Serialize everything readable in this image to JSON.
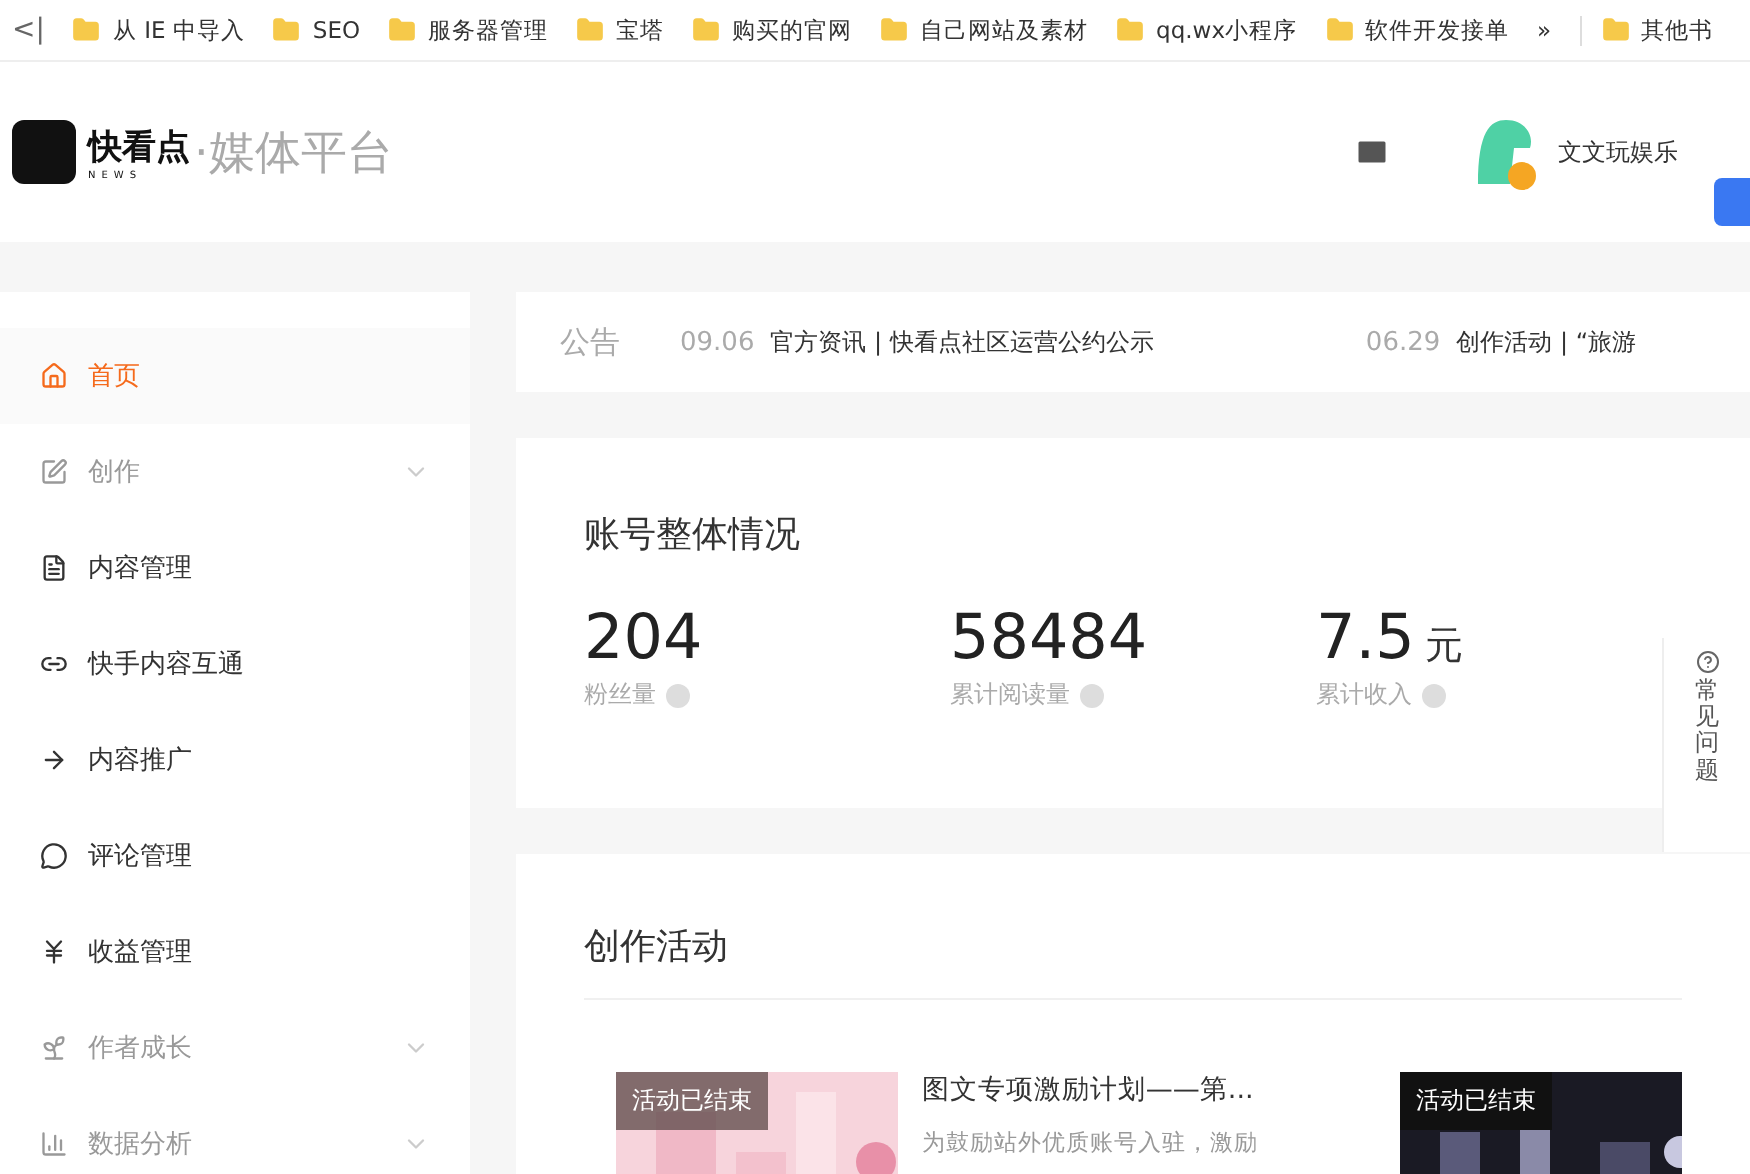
{
  "bookmarks": {
    "back": "<|",
    "items": [
      "从 IE 中导入",
      "SEO",
      "服务器管理",
      "宝塔",
      "购买的官网",
      "自己网站及素材",
      "qq.wx小程序",
      "软件开发接单"
    ],
    "more": "»",
    "other": "其他书"
  },
  "header": {
    "logo_text": "快看点",
    "logo_sub": "NEWS",
    "platform": "·媒体平台",
    "username": "文文玩娱乐"
  },
  "sidebar": {
    "items": [
      {
        "label": "首页",
        "selected": true,
        "expandable": false,
        "disabled": false
      },
      {
        "label": "创作",
        "selected": false,
        "expandable": true,
        "disabled": true
      },
      {
        "label": "内容管理",
        "selected": false,
        "expandable": false,
        "disabled": false
      },
      {
        "label": "快手内容互通",
        "selected": false,
        "expandable": false,
        "disabled": false
      },
      {
        "label": "内容推广",
        "selected": false,
        "expandable": false,
        "disabled": false
      },
      {
        "label": "评论管理",
        "selected": false,
        "expandable": false,
        "disabled": false
      },
      {
        "label": "收益管理",
        "selected": false,
        "expandable": false,
        "disabled": false
      },
      {
        "label": "作者成长",
        "selected": false,
        "expandable": true,
        "disabled": true
      },
      {
        "label": "数据分析",
        "selected": false,
        "expandable": true,
        "disabled": true
      }
    ]
  },
  "notice": {
    "label": "公告",
    "items": [
      {
        "date": "09.06",
        "category": "官方资讯",
        "separator": "|",
        "title": "快看点社区运营公约公示"
      },
      {
        "date": "06.29",
        "category": "创作活动",
        "separator": "|",
        "title": "“旅游"
      }
    ]
  },
  "overview": {
    "title": "账号整体情况",
    "stats": [
      {
        "value": "204",
        "label": "粉丝量"
      },
      {
        "value": "58484",
        "label": "累计阅读量"
      },
      {
        "value": "7.5",
        "unit": "元",
        "label": "累计收入"
      }
    ]
  },
  "help": {
    "label": "常见问题"
  },
  "activities": {
    "title": "创作活动",
    "items": [
      {
        "badge": "活动已结束",
        "title": "图文专项激励计划——第...",
        "desc": "为鼓励站外优质账号入驻，激励"
      },
      {
        "badge": "活动已结束"
      }
    ]
  }
}
